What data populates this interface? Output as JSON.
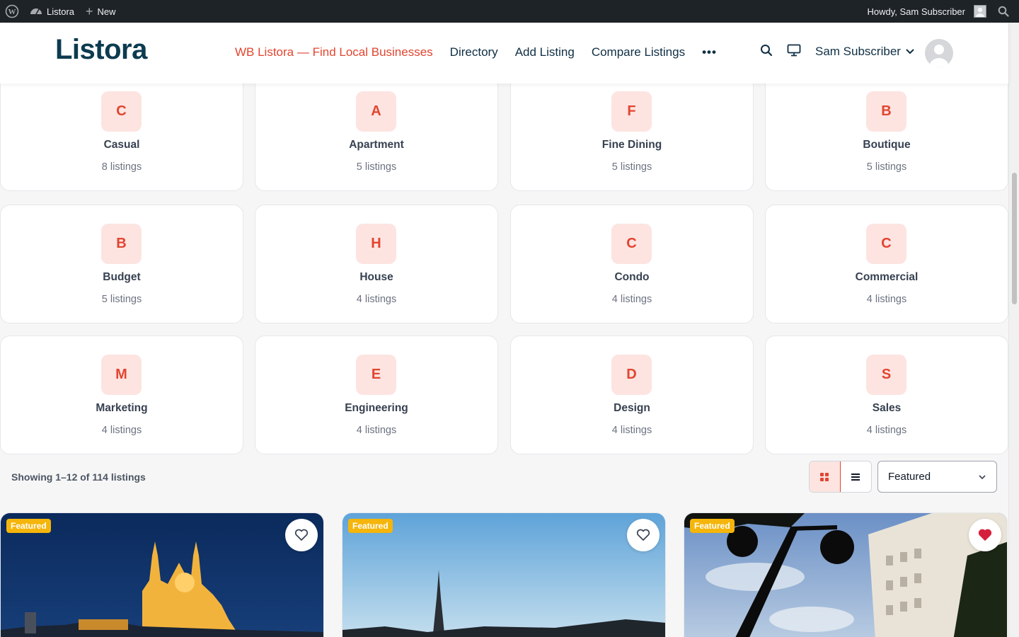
{
  "admin_bar": {
    "site_name": "Listora",
    "new_label": "New",
    "howdy": "Howdy, Sam Subscriber"
  },
  "header": {
    "logo": "Listora",
    "nav": [
      {
        "label": "WB Listora — Find Local Businesses",
        "active": true
      },
      {
        "label": "Directory",
        "active": false
      },
      {
        "label": "Add Listing",
        "active": false
      },
      {
        "label": "Compare Listings",
        "active": false
      }
    ],
    "more_label": "•••",
    "user_name": "Sam Subscriber"
  },
  "categories": [
    {
      "letter": "C",
      "name": "Casual",
      "count": "8 listings"
    },
    {
      "letter": "A",
      "name": "Apartment",
      "count": "5 listings"
    },
    {
      "letter": "F",
      "name": "Fine Dining",
      "count": "5 listings"
    },
    {
      "letter": "B",
      "name": "Boutique",
      "count": "5 listings"
    },
    {
      "letter": "B",
      "name": "Budget",
      "count": "5 listings"
    },
    {
      "letter": "H",
      "name": "House",
      "count": "4 listings"
    },
    {
      "letter": "C",
      "name": "Condo",
      "count": "4 listings"
    },
    {
      "letter": "C",
      "name": "Commercial",
      "count": "4 listings"
    },
    {
      "letter": "M",
      "name": "Marketing",
      "count": "4 listings"
    },
    {
      "letter": "E",
      "name": "Engineering",
      "count": "4 listings"
    },
    {
      "letter": "D",
      "name": "Design",
      "count": "4 listings"
    },
    {
      "letter": "S",
      "name": "Sales",
      "count": "4 listings"
    }
  ],
  "results": {
    "count_text": "Showing 1–12 of 114 listings",
    "sort_selected": "Featured",
    "view_mode": "grid"
  },
  "listings": [
    {
      "badge": "Featured",
      "favorited": false,
      "image": "night-basilica-photo"
    },
    {
      "badge": "Featured",
      "favorited": false,
      "image": "eiffel-tower-photo"
    },
    {
      "badge": "Featured",
      "favorited": true,
      "image": "street-lamp-building-photo"
    }
  ],
  "colors": {
    "accent": "#e2452f",
    "brand_dark": "#0d3b4f",
    "badge": "#f5b50b",
    "admin_bar": "#1d2327"
  }
}
